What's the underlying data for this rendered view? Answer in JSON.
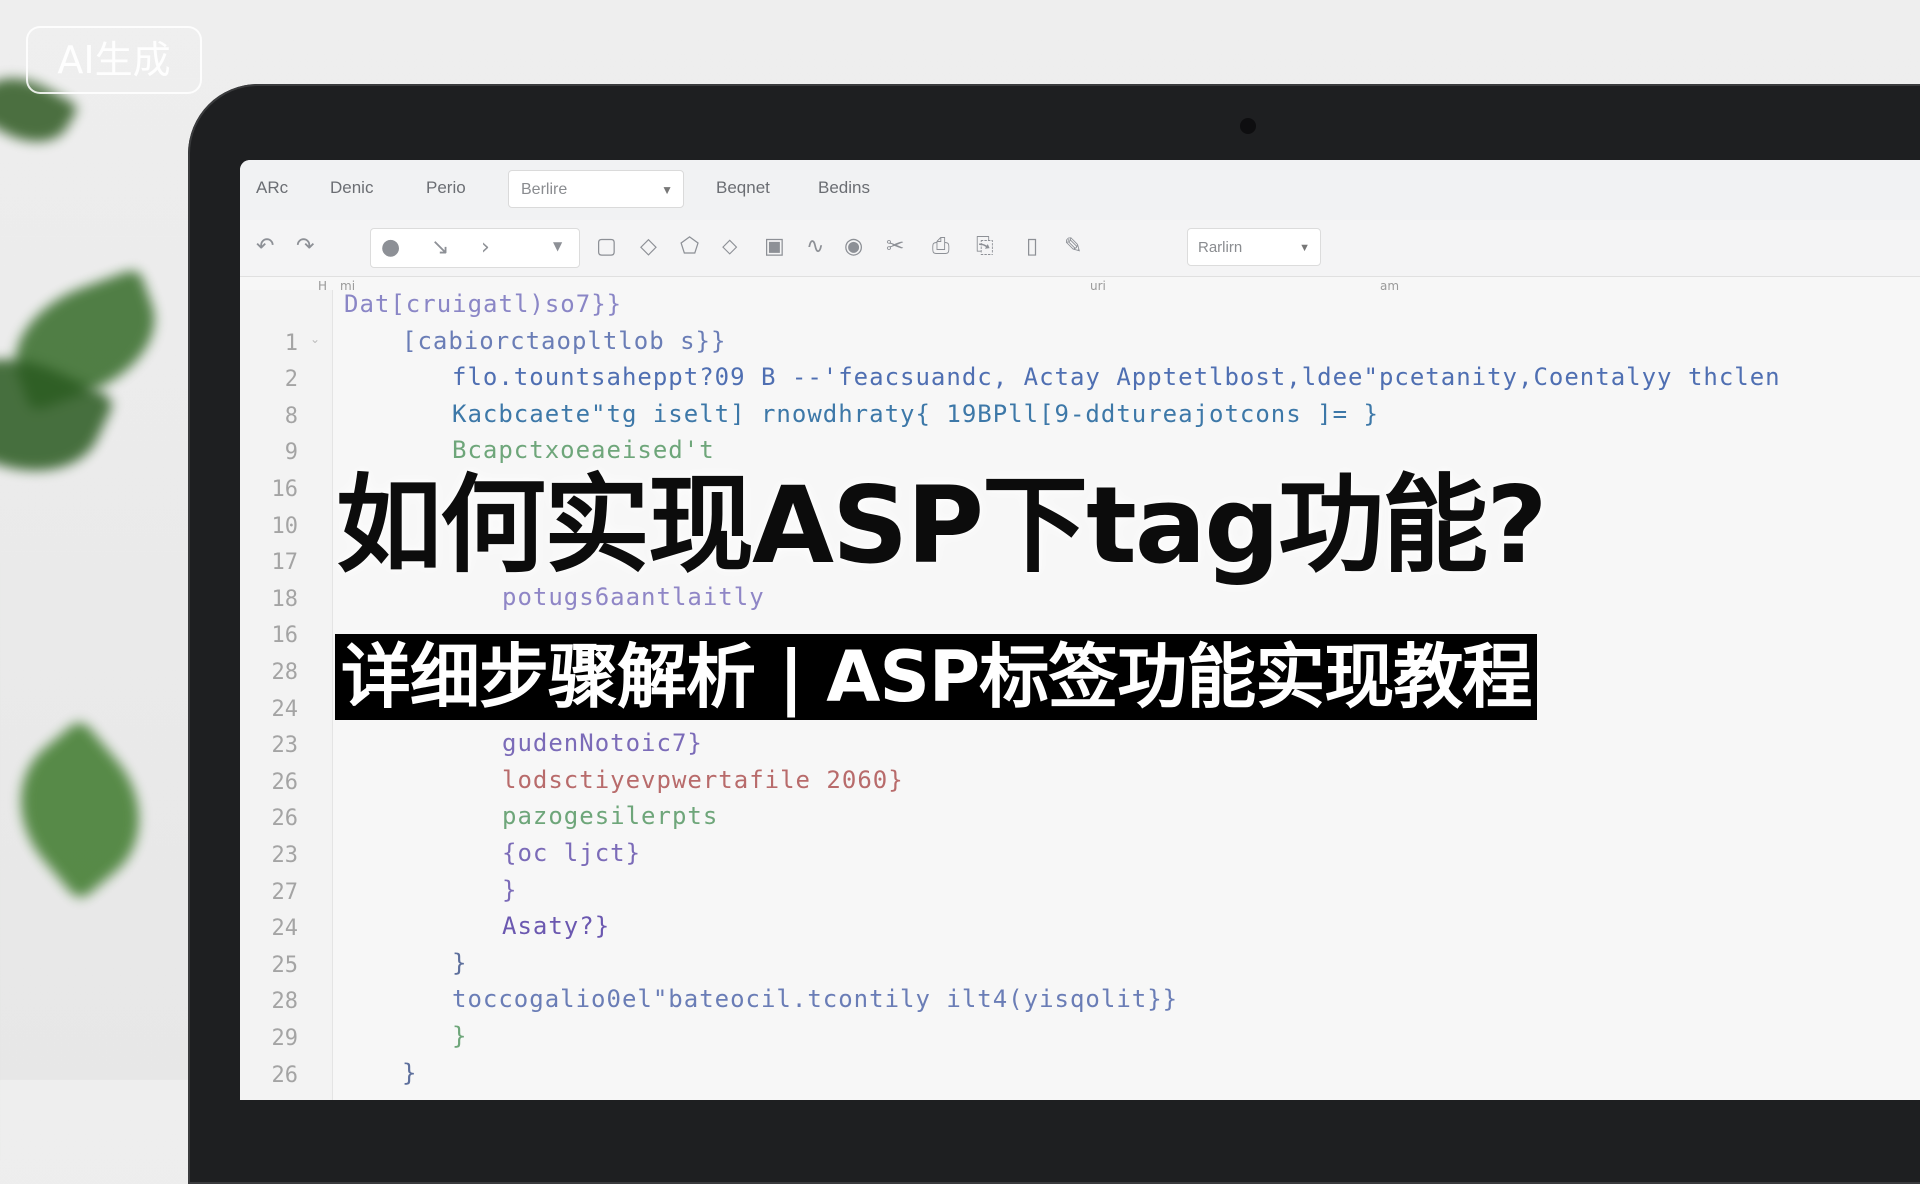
{
  "watermark": {
    "label": "AI生成"
  },
  "menubar": {
    "items": [
      "ARc",
      "Denic",
      "Perio",
      "Beqnet",
      "Bedins"
    ],
    "select_value": "Berlire"
  },
  "toolbar": {
    "select_value": "Rarlirn",
    "ruler": [
      "H",
      "mi",
      "uri",
      "am"
    ],
    "icons": [
      "undo-icon",
      "redo-icon",
      "brush-icon",
      "pointer-icon",
      "arrow-icon",
      "square-icon",
      "diamond-icon",
      "shape-icon",
      "tag-icon",
      "image-icon",
      "wave-icon",
      "circle-icon",
      "scissors-icon",
      "printer-icon",
      "format-icon",
      "comment-icon",
      "edit-icon"
    ]
  },
  "editor": {
    "lines": [
      {
        "num": "",
        "text": "Dat[cruigatl)so7}}",
        "indent": 0,
        "color": "#8a86c6"
      },
      {
        "num": "1",
        "text": "[cabiorctaopltlob s}}",
        "indent": 1,
        "color": "#6a7db6"
      },
      {
        "num": "2",
        "text": "flo.tountsaheppt?09 B --'feacsuandc, Actay Apptetlbost,ldee\"pcetanity,Coentalyy thclen",
        "indent": 2,
        "color": "#4f6fb2"
      },
      {
        "num": "8",
        "text": "Kacbcaete\"tg iselt] rnowdhraty{ 19BPll[9-ddtureajotcons ]= }",
        "indent": 2,
        "color": "#3d78a8"
      },
      {
        "num": "9",
        "text": "Bcapctxoeaeised't",
        "indent": 2,
        "color": "#6ea67a"
      },
      {
        "num": "16",
        "text": "",
        "indent": 3,
        "color": "#6ea67a"
      },
      {
        "num": "10",
        "text": "",
        "indent": 3,
        "color": "#8a86c6"
      },
      {
        "num": "17",
        "text": "",
        "indent": 3,
        "color": "#8a86c6"
      },
      {
        "num": "18",
        "text": "potugs6aantlaitly",
        "indent": 3,
        "color": "#8f86c6"
      },
      {
        "num": "16",
        "text": "",
        "indent": 3,
        "color": "#8a86c6"
      },
      {
        "num": "28",
        "text": "",
        "indent": 3,
        "color": "#8a86c6"
      },
      {
        "num": "24",
        "text": "",
        "indent": 3,
        "color": "#8a86c6"
      },
      {
        "num": "23",
        "text": "gudenNotoic7}",
        "indent": 3,
        "color": "#7b6bb8"
      },
      {
        "num": "26",
        "text": "lodsctiyevpwertafile 2060}",
        "indent": 3,
        "color": "#b86b6b"
      },
      {
        "num": "26",
        "text": "pazogesilerpts",
        "indent": 3,
        "color": "#6ea67a"
      },
      {
        "num": "23",
        "text": "{oc ljct}",
        "indent": 3,
        "color": "#7b6bb8"
      },
      {
        "num": "27",
        "text": "}",
        "indent": 3,
        "color": "#7b6bb8"
      },
      {
        "num": "24",
        "text": "Asaty?}",
        "indent": 3,
        "color": "#6b58b0"
      },
      {
        "num": "25",
        "text": "}",
        "indent": 2,
        "color": "#5d6f9c"
      },
      {
        "num": "28",
        "text": "toccogalio0el\"bateocil.tcontily ilt4(yisqolit}}",
        "indent": 2,
        "color": "#6a7db6"
      },
      {
        "num": "29",
        "text": "}",
        "indent": 2,
        "color": "#6ea67a"
      },
      {
        "num": "26",
        "text": "}",
        "indent": 1,
        "color": "#5d6f9c"
      }
    ]
  },
  "overlay": {
    "title": "如何实现ASP下tag功能?",
    "subtitle": "详细步骤解析 | ASP标签功能实现教程"
  },
  "colors": {
    "title_bg": "#000000",
    "title_text": "#0c0c0c",
    "subtitle_text": "#ffffff"
  }
}
